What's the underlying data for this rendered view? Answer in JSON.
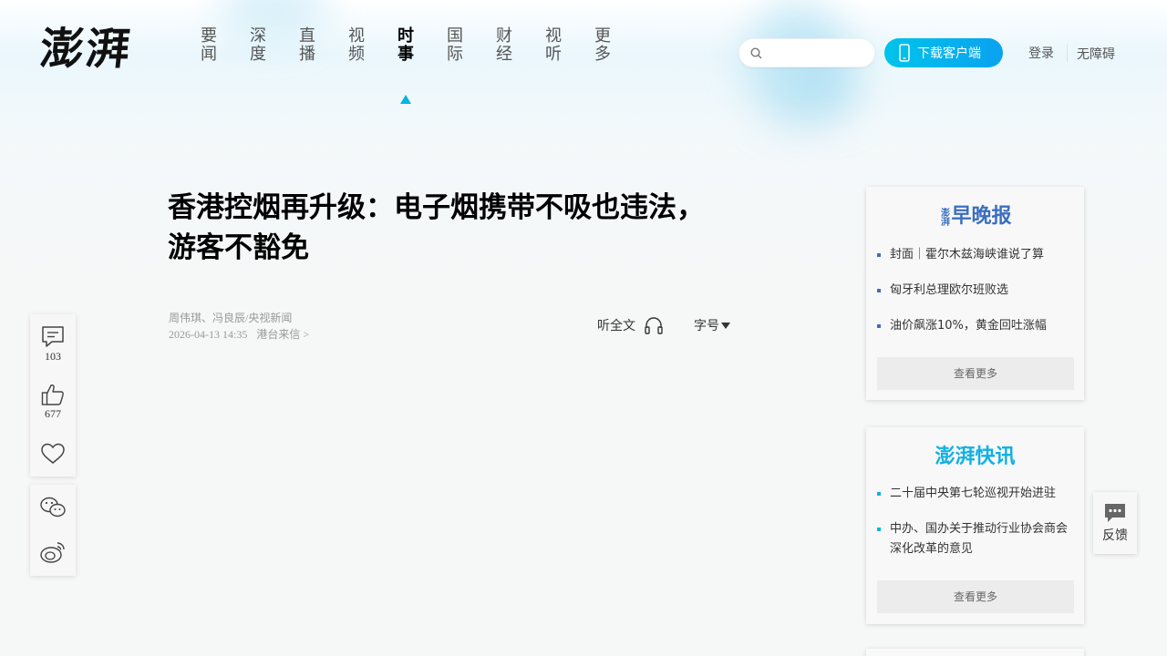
{
  "logo": {
    "text": "澎湃"
  },
  "nav": {
    "items": [
      {
        "line1": "要",
        "line2": "闻"
      },
      {
        "line1": "深",
        "line2": "度"
      },
      {
        "line1": "直",
        "line2": "播"
      },
      {
        "line1": "视",
        "line2": "频"
      },
      {
        "line1": "时",
        "line2": "事"
      },
      {
        "line1": "国",
        "line2": "际"
      },
      {
        "line1": "财",
        "line2": "经"
      },
      {
        "line1": "视",
        "line2": "听"
      },
      {
        "line1": "更",
        "line2": "多"
      }
    ],
    "active_index": 4
  },
  "search": {
    "placeholder": "",
    "value": ""
  },
  "header": {
    "download_label": "下载客户端",
    "login_label": "登录",
    "accessibility_label": "无障碍"
  },
  "article": {
    "title_line1": "香港控烟再升级：电子烟携带不吸也违法，",
    "title_line2": "游客不豁免",
    "authors": "周伟琪、冯良辰/央视新闻",
    "date": "2026-04-13 14:35",
    "source": "港台来信 >",
    "listen_label": "听全文",
    "fontsize_label": "字号"
  },
  "toolbar": {
    "comments_count": "103",
    "likes_count": "677"
  },
  "cards": {
    "evening": {
      "logo_small": "澎湃",
      "logo_main": "早晚报",
      "items": [
        "封面｜霍尔木兹海峡谁说了算",
        "匈牙利总理欧尔班败选",
        "油价飙涨10%，黄金回吐涨幅"
      ],
      "more_label": "查看更多"
    },
    "flash": {
      "logo_main": "澎湃快讯",
      "items": [
        "二十届中央第七轮巡视开始进驻",
        "中办、国办关于推动行业协会商会深化改革的意见"
      ],
      "more_label": "查看更多"
    }
  },
  "feedback": {
    "label": "反馈"
  },
  "colors": {
    "accent": "#00b6e0",
    "evening_blue": "#3b6fc0",
    "flash_cyan": "#10b1e3"
  }
}
